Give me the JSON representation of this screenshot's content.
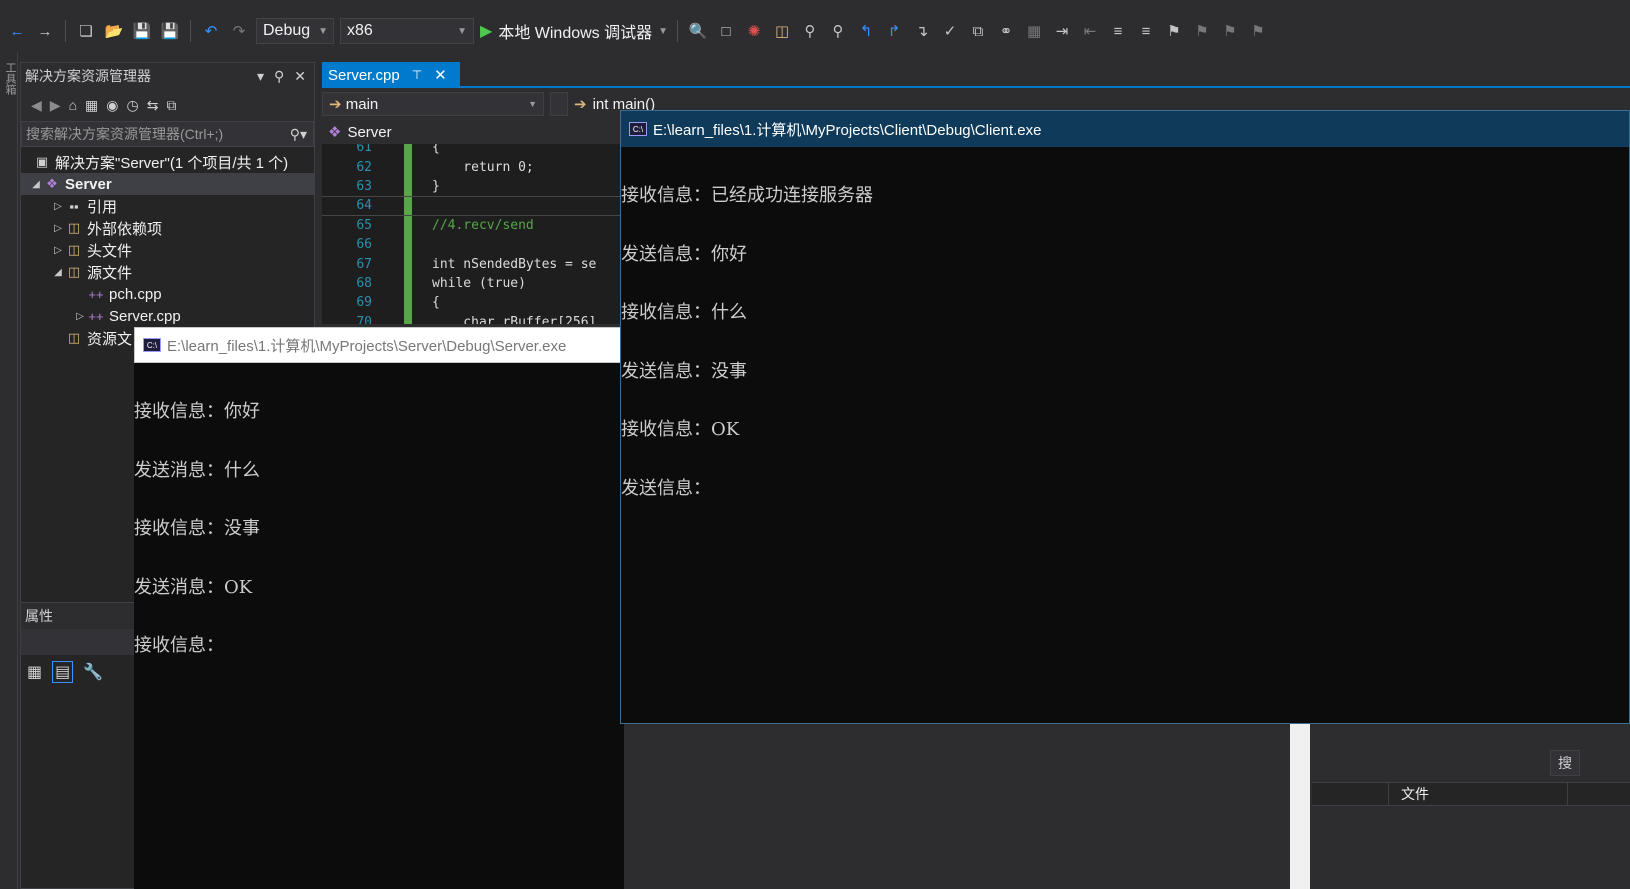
{
  "toolbar": {
    "config": "Debug",
    "platform": "x86",
    "run_label": "本地 Windows 调试器"
  },
  "solution_explorer": {
    "title": "解决方案资源管理器",
    "search_placeholder": "搜索解决方案资源管理器(Ctrl+;)",
    "solution_label": "解决方案\"Server\"(1 个项目/共 1 个)",
    "project": "Server",
    "items": [
      {
        "label": "引用"
      },
      {
        "label": "外部依赖项"
      },
      {
        "label": "头文件"
      },
      {
        "label": "源文件"
      },
      {
        "label": "pch.cpp"
      },
      {
        "label": "Server.cpp"
      },
      {
        "label": "资源文"
      }
    ]
  },
  "properties": {
    "title": "属性"
  },
  "editor": {
    "tab": "Server.cpp",
    "scope": "main",
    "function": "int main()",
    "project": "Server",
    "lines": [
      {
        "n": "61",
        "text": "{"
      },
      {
        "n": "62",
        "text": "    return 0;"
      },
      {
        "n": "63",
        "text": "}"
      },
      {
        "n": "64",
        "text": ""
      },
      {
        "n": "65",
        "text": "//4.recv/send"
      },
      {
        "n": "66",
        "text": ""
      },
      {
        "n": "67",
        "text": "int nSendedBytes = se"
      },
      {
        "n": "68",
        "text": "while (true)"
      },
      {
        "n": "69",
        "text": "{"
      },
      {
        "n": "70",
        "text": "    char rBuffer[256]"
      }
    ]
  },
  "client_console": {
    "title": "E:\\learn_files\\1.计算机\\MyProjects\\Client\\Debug\\Client.exe",
    "lines": [
      "接收信息：已经成功连接服务器",
      "发送信息：你好",
      "接收信息：什么",
      "发送信息：没事",
      "接收信息：OK",
      "发送信息："
    ]
  },
  "server_console": {
    "title": "E:\\learn_files\\1.计算机\\MyProjects\\Server\\Debug\\Server.exe",
    "lines": [
      "接收信息：你好",
      "发送消息：什么",
      "接收信息：没事",
      "发送消息：OK",
      "接收信息："
    ]
  },
  "bottom_panel": {
    "search_label": "搜",
    "column": "文件"
  }
}
